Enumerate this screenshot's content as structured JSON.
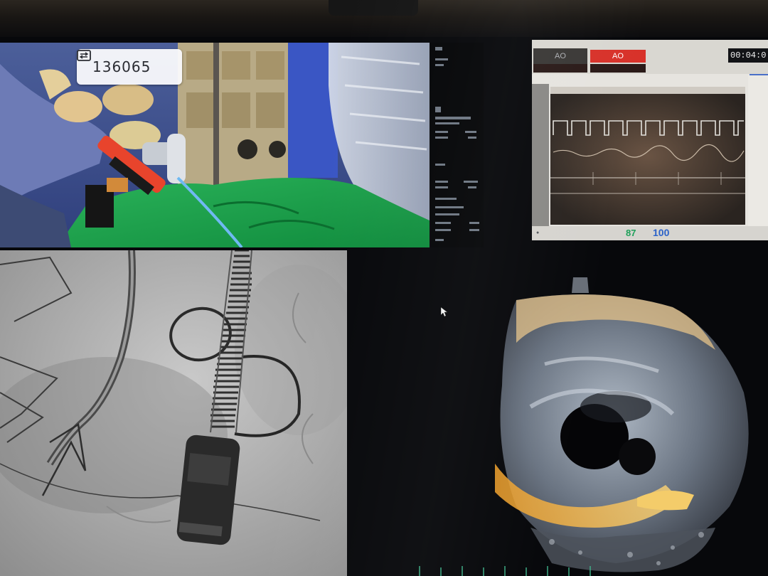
{
  "camera_feed": {
    "room_number": "136065",
    "room_icon": "video-room-icon"
  },
  "side_readout": {
    "rows": [
      "",
      "",
      "",
      "",
      "",
      "",
      ""
    ]
  },
  "monitor": {
    "header_left_label": "AO",
    "header_center_label": "AO",
    "timer": "00:04:0",
    "heart_rate": "87",
    "spo2": "100",
    "colors": {
      "alarm": "#d8322a",
      "heart_rate": "#1fa05a",
      "spo2": "#2b62c9"
    }
  },
  "fluoroscopy": {
    "icon": "xray-image"
  },
  "echo_3d": {
    "icon": "3d-echo-render"
  }
}
